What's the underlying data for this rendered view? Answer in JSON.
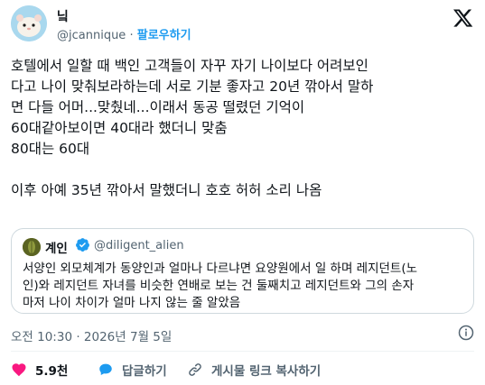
{
  "author": {
    "name": "닠",
    "handle": "@jcannique",
    "separator": "·",
    "follow_label": "팔로우하기"
  },
  "tweet": {
    "lines": [
      "호텔에서 일할 때 백인 고객들이 자꾸 자기 나이보다 어려보인",
      "다고 나이 맞춰보라하는데 서로 기분 좋자고 20년 깎아서 말하",
      "면 다들 어머...맞췄네...이래서 동공 떨렸던 기억이",
      "60대같아보이면 40대라 했더니 맞춤",
      "80대는 60대",
      "",
      "이후 아예 35년 깎아서 말했더니 호호 허허 소리 나옴"
    ]
  },
  "quote": {
    "name": "계인",
    "handle": "@diligent_alien",
    "lines": [
      "서양인 외모체계가 동양인과 얼마나 다르냐면 요양원에서 일 하며 레지던트(노",
      "인)와 레지던트 자녀를 비슷한 연배로 보는 건 둘째치고 레지던트와  그의 손자",
      "마저 나이 차이가 얼마 나지 않는 줄 알았음"
    ]
  },
  "meta": {
    "timestamp": "오전 10:30 · 2026년 7월 5일"
  },
  "actions": {
    "like_count": "5.9천",
    "reply_label": "답글하기",
    "copy_link_label": "게시물 링크 복사하기"
  },
  "colors": {
    "accent": "#1d9bf0",
    "like": "#f91880",
    "muted": "#536471",
    "border": "#cfd9de"
  },
  "icons": {
    "logo": "x-logo-icon",
    "verified": "verified-badge-icon",
    "info": "info-icon",
    "like": "heart-icon",
    "reply": "speech-bubble-icon",
    "link": "link-icon"
  }
}
